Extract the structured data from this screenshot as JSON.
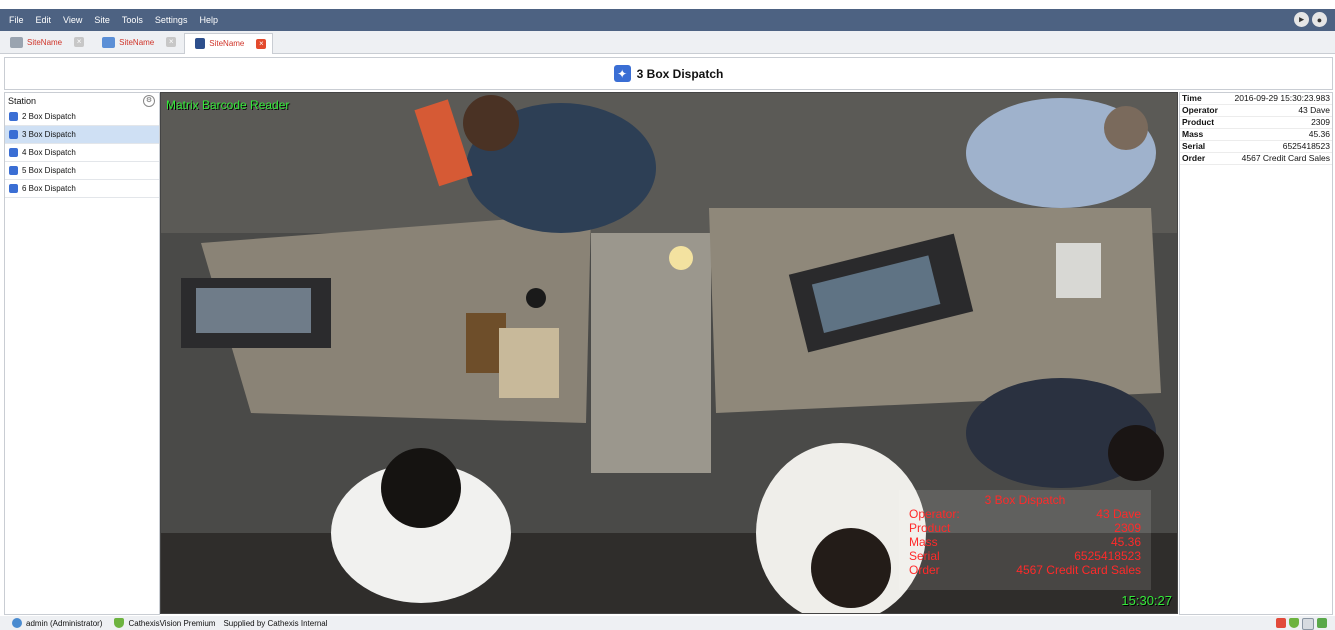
{
  "menu": [
    "File",
    "Edit",
    "View",
    "Site",
    "Tools",
    "Settings",
    "Help"
  ],
  "menu_right_icons": [
    "volume-icon",
    "user-icon"
  ],
  "tabs": [
    {
      "label": "SiteName",
      "icon": "network-icon",
      "active": false
    },
    {
      "label": "SiteName",
      "icon": "monitor-icon",
      "active": false
    },
    {
      "label": "SiteName",
      "icon": "camera-icon",
      "active": true
    }
  ],
  "title": {
    "icon": "puzzle-icon",
    "text": "3 Box Dispatch"
  },
  "stations": {
    "header": "Station",
    "items": [
      {
        "label": "2 Box Dispatch",
        "selected": false
      },
      {
        "label": "3 Box Dispatch",
        "selected": true
      },
      {
        "label": "4 Box Dispatch",
        "selected": false
      },
      {
        "label": "5 Box Dispatch",
        "selected": false
      },
      {
        "label": "6 Box Dispatch",
        "selected": false
      }
    ]
  },
  "video": {
    "title": "Matrix Barcode Reader",
    "timestamp": "15:30:27",
    "overlay": {
      "title": "3 Box Dispatch",
      "rows": [
        {
          "k": "Operator:",
          "v": "43 Dave"
        },
        {
          "k": "Product",
          "v": "2309"
        },
        {
          "k": "Mass",
          "v": "45.36"
        },
        {
          "k": "Serial",
          "v": "6525418523"
        },
        {
          "k": "Order",
          "v": "4567 Credit Card Sales"
        }
      ]
    }
  },
  "info": [
    {
      "k": "Time",
      "v": "2016-09-29 15:30:23.983"
    },
    {
      "k": "Operator",
      "v": "43 Dave"
    },
    {
      "k": "Product",
      "v": "2309"
    },
    {
      "k": "Mass",
      "v": "45.36"
    },
    {
      "k": "Serial",
      "v": "6525418523"
    },
    {
      "k": "Order",
      "v": "4567 Credit Card Sales"
    }
  ],
  "status": {
    "user": "admin (Administrator)",
    "product": "CathexisVision Premium",
    "supplied": "Supplied by Cathexis Internal"
  },
  "colors": {
    "menubar": "#4d6282",
    "accent": "#3a6ed4",
    "tab_text": "#d0352a",
    "overlay_text": "#ff2a2a",
    "video_text": "#35e83a"
  }
}
